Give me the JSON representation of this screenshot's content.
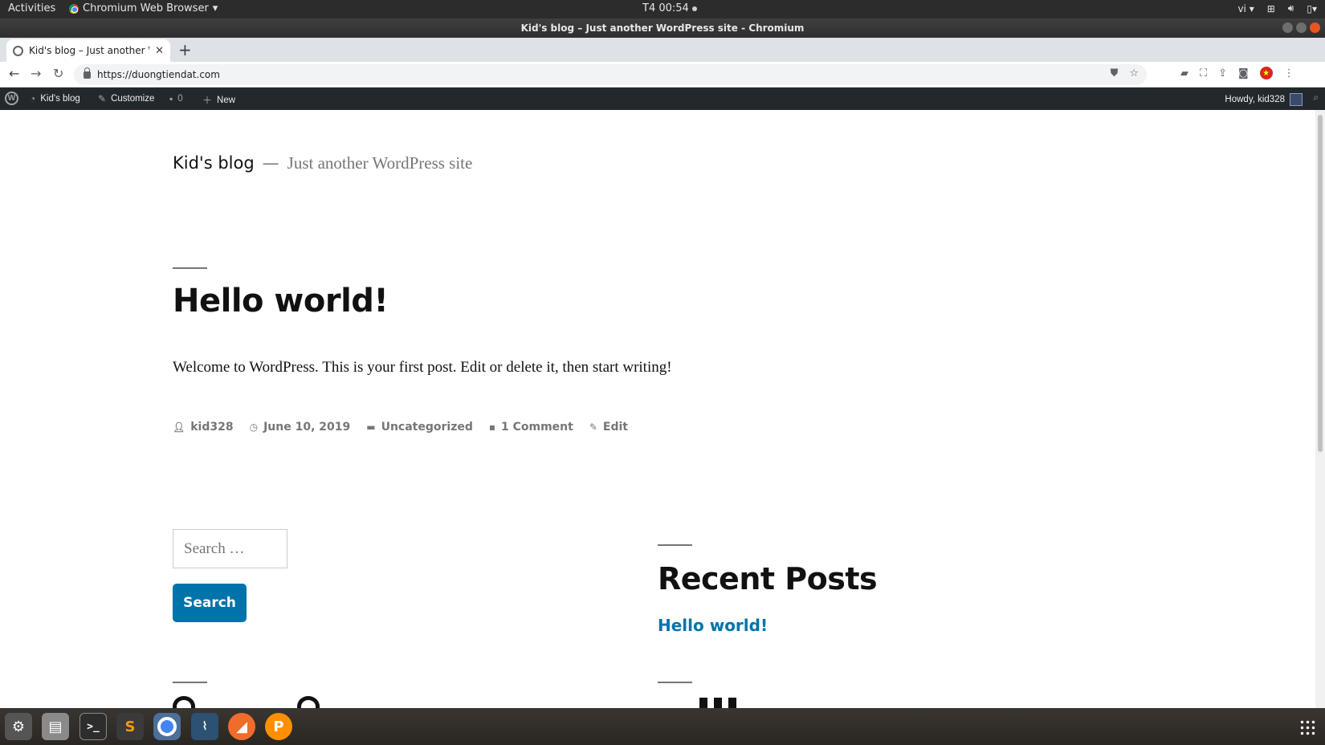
{
  "gnome": {
    "activities": "Activities",
    "app_menu": "Chromium Web Browser",
    "clock": "T4 00:54",
    "lang": "vi"
  },
  "window": {
    "title": "Kid's blog – Just another WordPress site - Chromium"
  },
  "browser": {
    "tab_title": "Kid's blog – Just another WordPress site",
    "url": "https://duongtiendat.com"
  },
  "adminbar": {
    "site_name": "Kid's blog",
    "customize": "Customize",
    "comments_count": "0",
    "new_label": "New",
    "howdy": "Howdy, kid328"
  },
  "site": {
    "title": "Kid's blog",
    "separator": "—",
    "description": "Just another WordPress site"
  },
  "post": {
    "title": "Hello world!",
    "body": "Welcome to WordPress. This is your first post. Edit or delete it, then start writing!",
    "author": "kid328",
    "date": "June 10, 2019",
    "category": "Uncategorized",
    "comments": "1 Comment",
    "edit": "Edit"
  },
  "widgets": {
    "search_placeholder": "Search …",
    "search_button": "Search",
    "recent_title": "Recent Posts",
    "recent_items": [
      "Hello world!"
    ]
  },
  "icons": {
    "accent_link": "#0073aa",
    "adminbar_bg": "#23282d"
  }
}
